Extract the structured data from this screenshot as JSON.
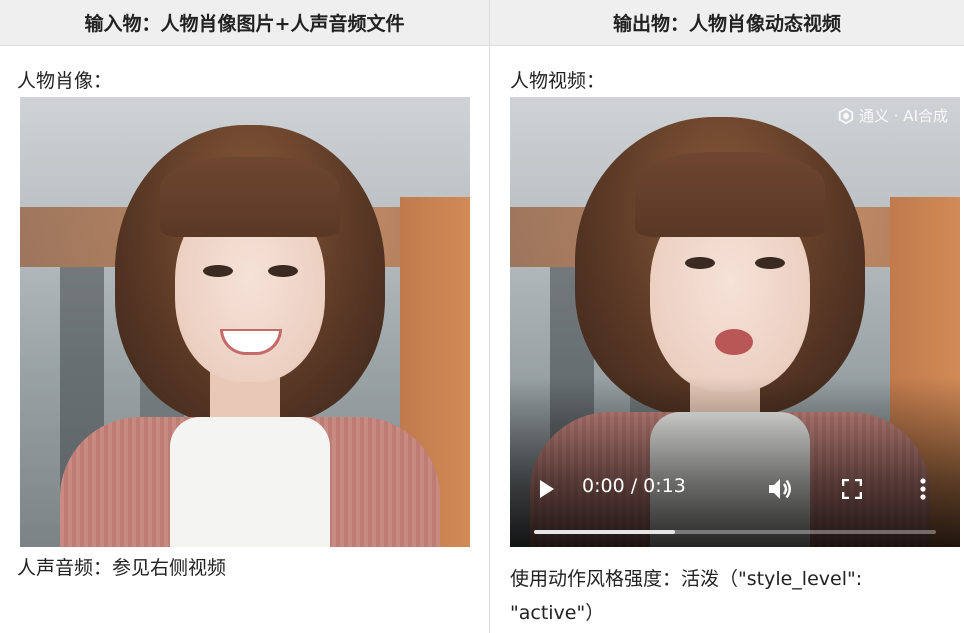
{
  "header": {
    "input_title": "输入物：人物肖像图片+人声音频文件",
    "output_title": "输出物：人物肖像动态视频"
  },
  "left": {
    "portrait_label": "人物肖像：",
    "audio_label": "人声音频：参见右侧视频"
  },
  "right": {
    "video_label": "人物视频：",
    "watermark": "通义 · AI合成",
    "player": {
      "current_time": "0:00",
      "duration": "0:13",
      "time_text": "0:00 / 0:13",
      "progress_fraction": 0.35,
      "play_icon": "play-icon",
      "volume_icon": "volume-icon",
      "fullscreen_icon": "fullscreen-icon",
      "more_icon": "more-vertical-icon"
    },
    "style_caption": "使用动作风格强度：活泼（\"style_level\": \"active\"）"
  },
  "colors": {
    "header_bg": "#efefef",
    "divider": "#dedede"
  }
}
